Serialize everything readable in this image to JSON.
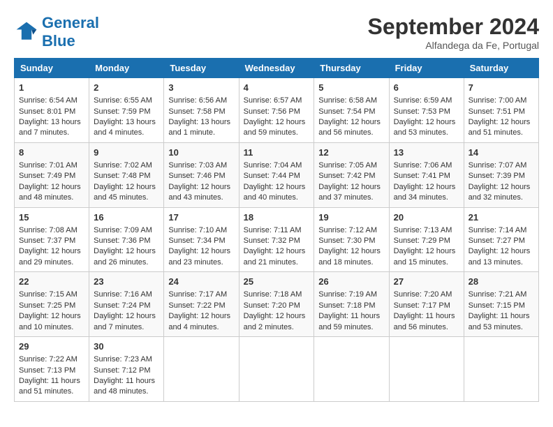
{
  "header": {
    "logo_text_general": "General",
    "logo_text_blue": "Blue",
    "month_title": "September 2024",
    "subtitle": "Alfandega da Fe, Portugal"
  },
  "weekdays": [
    "Sunday",
    "Monday",
    "Tuesday",
    "Wednesday",
    "Thursday",
    "Friday",
    "Saturday"
  ],
  "weeks": [
    [
      {
        "day": "1",
        "lines": [
          "Sunrise: 6:54 AM",
          "Sunset: 8:01 PM",
          "Daylight: 13 hours",
          "and 7 minutes."
        ]
      },
      {
        "day": "2",
        "lines": [
          "Sunrise: 6:55 AM",
          "Sunset: 7:59 PM",
          "Daylight: 13 hours",
          "and 4 minutes."
        ]
      },
      {
        "day": "3",
        "lines": [
          "Sunrise: 6:56 AM",
          "Sunset: 7:58 PM",
          "Daylight: 13 hours",
          "and 1 minute."
        ]
      },
      {
        "day": "4",
        "lines": [
          "Sunrise: 6:57 AM",
          "Sunset: 7:56 PM",
          "Daylight: 12 hours",
          "and 59 minutes."
        ]
      },
      {
        "day": "5",
        "lines": [
          "Sunrise: 6:58 AM",
          "Sunset: 7:54 PM",
          "Daylight: 12 hours",
          "and 56 minutes."
        ]
      },
      {
        "day": "6",
        "lines": [
          "Sunrise: 6:59 AM",
          "Sunset: 7:53 PM",
          "Daylight: 12 hours",
          "and 53 minutes."
        ]
      },
      {
        "day": "7",
        "lines": [
          "Sunrise: 7:00 AM",
          "Sunset: 7:51 PM",
          "Daylight: 12 hours",
          "and 51 minutes."
        ]
      }
    ],
    [
      {
        "day": "8",
        "lines": [
          "Sunrise: 7:01 AM",
          "Sunset: 7:49 PM",
          "Daylight: 12 hours",
          "and 48 minutes."
        ]
      },
      {
        "day": "9",
        "lines": [
          "Sunrise: 7:02 AM",
          "Sunset: 7:48 PM",
          "Daylight: 12 hours",
          "and 45 minutes."
        ]
      },
      {
        "day": "10",
        "lines": [
          "Sunrise: 7:03 AM",
          "Sunset: 7:46 PM",
          "Daylight: 12 hours",
          "and 43 minutes."
        ]
      },
      {
        "day": "11",
        "lines": [
          "Sunrise: 7:04 AM",
          "Sunset: 7:44 PM",
          "Daylight: 12 hours",
          "and 40 minutes."
        ]
      },
      {
        "day": "12",
        "lines": [
          "Sunrise: 7:05 AM",
          "Sunset: 7:42 PM",
          "Daylight: 12 hours",
          "and 37 minutes."
        ]
      },
      {
        "day": "13",
        "lines": [
          "Sunrise: 7:06 AM",
          "Sunset: 7:41 PM",
          "Daylight: 12 hours",
          "and 34 minutes."
        ]
      },
      {
        "day": "14",
        "lines": [
          "Sunrise: 7:07 AM",
          "Sunset: 7:39 PM",
          "Daylight: 12 hours",
          "and 32 minutes."
        ]
      }
    ],
    [
      {
        "day": "15",
        "lines": [
          "Sunrise: 7:08 AM",
          "Sunset: 7:37 PM",
          "Daylight: 12 hours",
          "and 29 minutes."
        ]
      },
      {
        "day": "16",
        "lines": [
          "Sunrise: 7:09 AM",
          "Sunset: 7:36 PM",
          "Daylight: 12 hours",
          "and 26 minutes."
        ]
      },
      {
        "day": "17",
        "lines": [
          "Sunrise: 7:10 AM",
          "Sunset: 7:34 PM",
          "Daylight: 12 hours",
          "and 23 minutes."
        ]
      },
      {
        "day": "18",
        "lines": [
          "Sunrise: 7:11 AM",
          "Sunset: 7:32 PM",
          "Daylight: 12 hours",
          "and 21 minutes."
        ]
      },
      {
        "day": "19",
        "lines": [
          "Sunrise: 7:12 AM",
          "Sunset: 7:30 PM",
          "Daylight: 12 hours",
          "and 18 minutes."
        ]
      },
      {
        "day": "20",
        "lines": [
          "Sunrise: 7:13 AM",
          "Sunset: 7:29 PM",
          "Daylight: 12 hours",
          "and 15 minutes."
        ]
      },
      {
        "day": "21",
        "lines": [
          "Sunrise: 7:14 AM",
          "Sunset: 7:27 PM",
          "Daylight: 12 hours",
          "and 13 minutes."
        ]
      }
    ],
    [
      {
        "day": "22",
        "lines": [
          "Sunrise: 7:15 AM",
          "Sunset: 7:25 PM",
          "Daylight: 12 hours",
          "and 10 minutes."
        ]
      },
      {
        "day": "23",
        "lines": [
          "Sunrise: 7:16 AM",
          "Sunset: 7:24 PM",
          "Daylight: 12 hours",
          "and 7 minutes."
        ]
      },
      {
        "day": "24",
        "lines": [
          "Sunrise: 7:17 AM",
          "Sunset: 7:22 PM",
          "Daylight: 12 hours",
          "and 4 minutes."
        ]
      },
      {
        "day": "25",
        "lines": [
          "Sunrise: 7:18 AM",
          "Sunset: 7:20 PM",
          "Daylight: 12 hours",
          "and 2 minutes."
        ]
      },
      {
        "day": "26",
        "lines": [
          "Sunrise: 7:19 AM",
          "Sunset: 7:18 PM",
          "Daylight: 11 hours",
          "and 59 minutes."
        ]
      },
      {
        "day": "27",
        "lines": [
          "Sunrise: 7:20 AM",
          "Sunset: 7:17 PM",
          "Daylight: 11 hours",
          "and 56 minutes."
        ]
      },
      {
        "day": "28",
        "lines": [
          "Sunrise: 7:21 AM",
          "Sunset: 7:15 PM",
          "Daylight: 11 hours",
          "and 53 minutes."
        ]
      }
    ],
    [
      {
        "day": "29",
        "lines": [
          "Sunrise: 7:22 AM",
          "Sunset: 7:13 PM",
          "Daylight: 11 hours",
          "and 51 minutes."
        ]
      },
      {
        "day": "30",
        "lines": [
          "Sunrise: 7:23 AM",
          "Sunset: 7:12 PM",
          "Daylight: 11 hours",
          "and 48 minutes."
        ]
      },
      {
        "day": "",
        "lines": []
      },
      {
        "day": "",
        "lines": []
      },
      {
        "day": "",
        "lines": []
      },
      {
        "day": "",
        "lines": []
      },
      {
        "day": "",
        "lines": []
      }
    ]
  ]
}
